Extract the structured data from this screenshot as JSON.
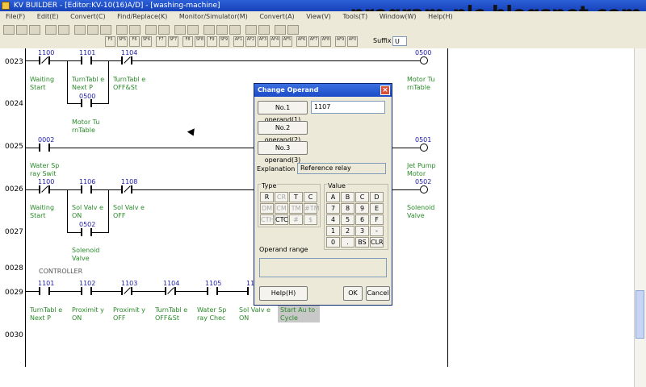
{
  "window": {
    "title": "KV BUILDER - [Editor:KV-10(16)A/D] - [washing-machine]"
  },
  "watermark": "program-plc.blogspot.com",
  "menu": [
    "File(F)",
    "Edit(E)",
    "Convert(C)",
    "Find/Replace(K)",
    "Monitor/Simulator(M)",
    "Convert(A)",
    "View(V)",
    "Tools(T)",
    "Window(W)",
    "Help(H)"
  ],
  "fkeys": [
    "F5",
    "SF5",
    "F6",
    "SF6",
    "F7",
    "SF7",
    "F8",
    "SF8",
    "F9",
    "SF9",
    "AF1",
    "AF2",
    "AF3",
    "AF4",
    "AF5",
    "AF6",
    "AF7",
    "AF8",
    "AF9",
    "AF0"
  ],
  "suffix": {
    "label": "Suffix",
    "value": "U"
  },
  "ladder": {
    "rows": [
      "0023",
      "0024",
      "0025",
      "0026",
      "0027",
      "0028",
      "0029",
      "0030"
    ],
    "addresses": [
      "1100",
      "1101",
      "1104",
      "0500",
      "0500",
      "0002",
      "0501",
      "1100",
      "1106",
      "1108",
      "0502",
      "0502",
      "1101",
      "1102",
      "1103",
      "1104",
      "1105",
      "11"
    ],
    "comments": [
      "Waiting Start",
      "TurnTabl e Next P",
      "TurnTabl e OFF&St",
      "Motor Tu rnTable",
      "Motor Tu rnTable",
      "Water Sp ray Swit",
      "Jet Pump Motor",
      "Waiting Start",
      "Sol Valv e ON",
      "Sol Valv e OFF",
      "Solenoid Valve",
      "Solenoid Valve",
      "TurnTabl e Next P",
      "Proximit y ON",
      "Proximit y OFF",
      "TurnTabl e OFF&St",
      "Water Sp ray Chec",
      "Sol Valv e ON",
      "Start Au to Cycle"
    ],
    "controller": "CONTROLLER"
  },
  "dialog": {
    "title": "Change Operand",
    "close": "×",
    "operand1_label": "No.1 operand(1)",
    "operand1_value": "1107",
    "operand2_label": "No.2 operand(2)",
    "operand3_label": "No.3 operand(3)",
    "explanation_label": "Explanation",
    "explanation_value": "Reference relay",
    "type_label": "Type",
    "type_keys": [
      "R",
      "CR",
      "T",
      "C",
      "DM",
      "CM",
      "TM",
      "#TM",
      "CTH",
      "CTC",
      "#",
      "$"
    ],
    "value_label": "Value",
    "value_keys": [
      "A",
      "B",
      "C",
      "D",
      "7",
      "8",
      "9",
      "E",
      "4",
      "5",
      "6",
      "F",
      "1",
      "2",
      "3",
      "-",
      "0",
      ".",
      "BS",
      "CLR"
    ],
    "range_label": "Operand range",
    "help": "Help(H)",
    "ok": "OK",
    "cancel": "Cancel"
  }
}
